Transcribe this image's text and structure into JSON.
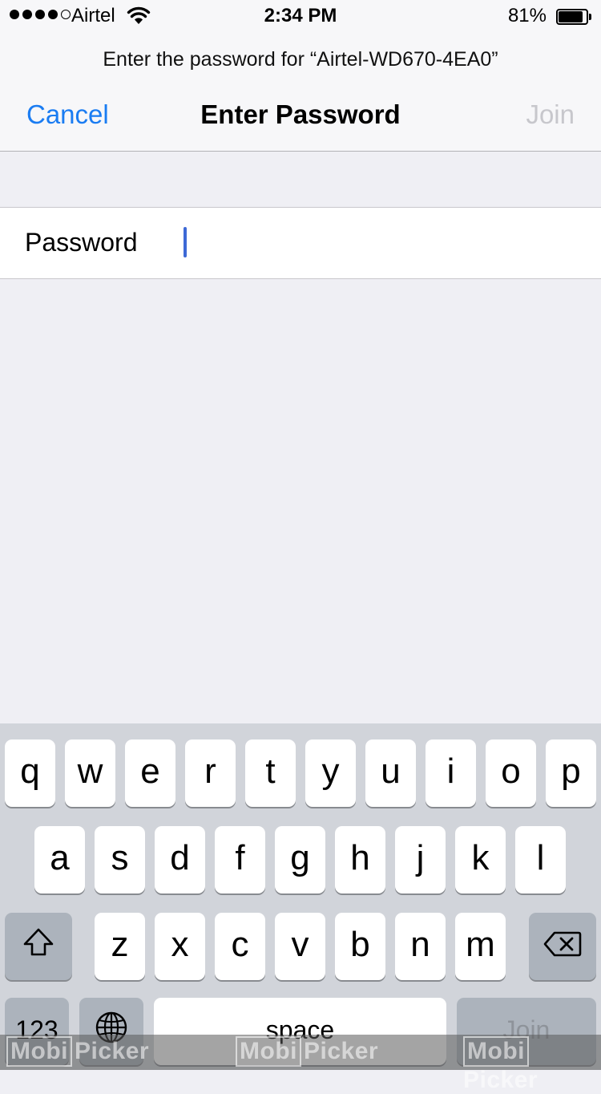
{
  "status_bar": {
    "carrier": "Airtel",
    "time": "2:34 PM",
    "battery_percent": "81%",
    "signal_bars_filled": 4,
    "signal_bars_total": 5,
    "battery_level": 0.81
  },
  "header": {
    "prompt": "Enter the password for “Airtel-WD670-4EA0”",
    "cancel_label": "Cancel",
    "title": "Enter Password",
    "join_label": "Join",
    "accent_color": "#1a7cf2",
    "disabled_color": "#c7c7cc"
  },
  "form": {
    "password_label": "Password",
    "password_value": ""
  },
  "keyboard": {
    "row1": [
      "q",
      "w",
      "e",
      "r",
      "t",
      "y",
      "u",
      "i",
      "o",
      "p"
    ],
    "row2": [
      "a",
      "s",
      "d",
      "f",
      "g",
      "h",
      "j",
      "k",
      "l"
    ],
    "row3": [
      "z",
      "x",
      "c",
      "v",
      "b",
      "n",
      "m"
    ],
    "numbers_label": "123",
    "space_label": "space",
    "join_label": "Join"
  },
  "watermark": {
    "text_a": "Mobi",
    "text_b": "Picker"
  }
}
